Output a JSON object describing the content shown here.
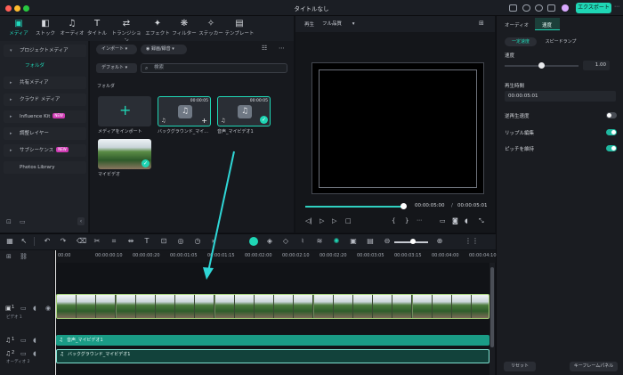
{
  "app": {
    "window_title": "タイトルなし",
    "export_label": "エクスポート"
  },
  "media_tabs": [
    {
      "label": "メディア",
      "icon": "media-icon",
      "active": true
    },
    {
      "label": "ストック",
      "icon": "stock-icon"
    },
    {
      "label": "オーディオ",
      "icon": "audio-note-icon"
    },
    {
      "label": "タイトル",
      "icon": "text-icon"
    },
    {
      "label": "トランジション",
      "icon": "transition-icon"
    },
    {
      "label": "エフェクト",
      "icon": "effect-icon"
    },
    {
      "label": "フィルター",
      "icon": "filter-icon"
    },
    {
      "label": "ステッカー",
      "icon": "sticker-icon"
    },
    {
      "label": "テンプレート",
      "icon": "template-icon"
    }
  ],
  "sidebar": {
    "items": [
      {
        "label": "プロジェクトメディア",
        "expanded": true
      },
      {
        "label": "フォルダ",
        "sub": true
      },
      {
        "label": "共有メディア"
      },
      {
        "label": "クラウド メディア"
      },
      {
        "label": "Influence Kit",
        "badge": "NEW"
      },
      {
        "label": "調整レイヤー"
      },
      {
        "label": "サブシーケンス",
        "badge": "NEW"
      },
      {
        "label": "Photos Library"
      }
    ]
  },
  "media": {
    "import_label": "インポート",
    "record_label": "録画/録音",
    "sort_label": "デフォルト",
    "search_placeholder": "検索",
    "folder_label": "フォルダ",
    "items": [
      {
        "caption": "メディアをインポート",
        "type": "import"
      },
      {
        "caption": "バックグラウンド_マイ...",
        "duration": "00:00:05",
        "type": "audio"
      },
      {
        "caption": "音声_マイビデオ1",
        "duration": "00:00:05",
        "type": "audio",
        "selected": true
      },
      {
        "caption": "マイビデオ",
        "type": "video"
      }
    ]
  },
  "player": {
    "label": "再生",
    "quality": "フル品質",
    "current_time": "00:00:05:00",
    "separator": "/",
    "total_time": "00:00:05:01",
    "progress": 1.0
  },
  "right_panel": {
    "tabs": [
      "オーディオ",
      "速度"
    ],
    "active_tab": "速度",
    "speed_modes": [
      "一定速度",
      "スピードランプ"
    ],
    "speed_label": "速度",
    "speed_value": "1.00",
    "duration_label": "再生時間",
    "duration_value": "00:00:05:01",
    "toggles": [
      {
        "label": "逆再生速度",
        "on": false
      },
      {
        "label": "リップル編集",
        "on": true
      },
      {
        "label": "ピッチを維持",
        "on": true
      }
    ],
    "reset_label": "リセット",
    "keyframe_label": "キーフレームパネル"
  },
  "timeline": {
    "ruler": [
      "00:00",
      "00:00:00:10",
      "00:00:00:20",
      "00:00:01:05",
      "00:00:01:15",
      "00:00:02:00",
      "00:00:02:10",
      "00:00:02:20",
      "00:00:03:05",
      "00:00:03:15",
      "00:00:04:00",
      "00:00:04:10"
    ],
    "video_track_label": "ビデオ 1",
    "audio_track_label": "オーディオ 2",
    "audio_clips": [
      "音声_マイビデオ1",
      "バックグラウンド_マイビデオ1"
    ],
    "video_track_index": "1",
    "audio_track_index_1": "1",
    "audio_track_index_2": "2"
  },
  "colors": {
    "accent": "#1fd6b5",
    "audio_clip": "#1a9c86",
    "arrow": "#2fd6d6"
  }
}
